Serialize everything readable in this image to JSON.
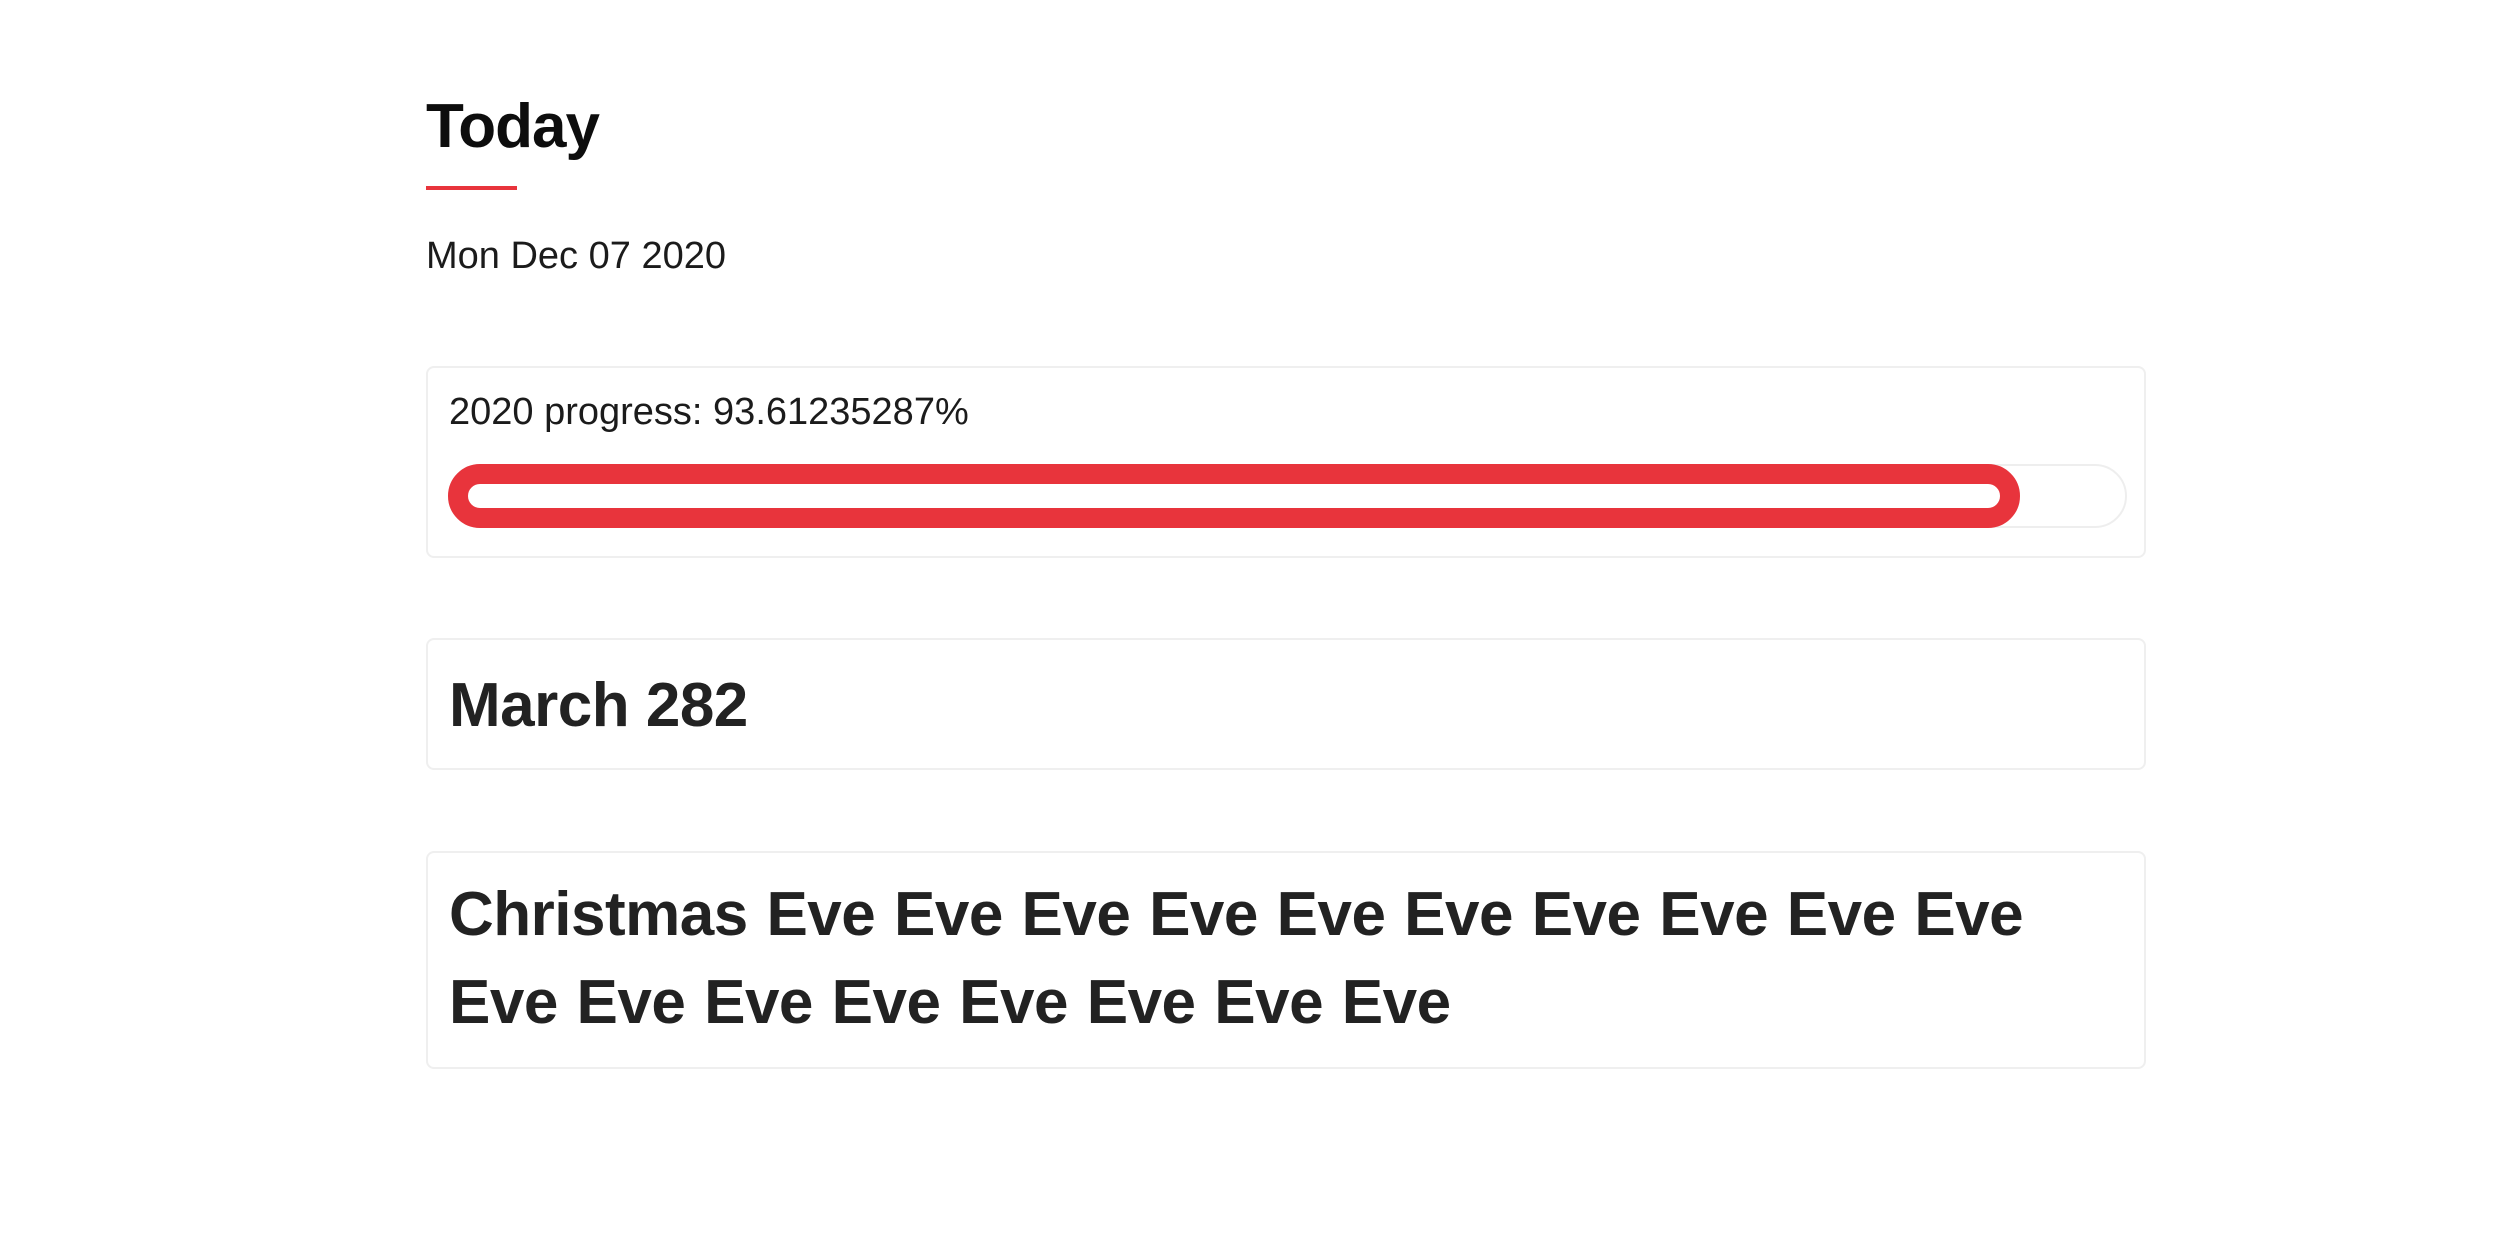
{
  "page": {
    "title": "Today",
    "date": "Mon Dec 07 2020",
    "accent_color": "#e8343c"
  },
  "progress": {
    "label": "2020 progress: 93.61235287%",
    "fraction": 0.9361235287
  },
  "cards": {
    "march_text": "March 282",
    "christmas_text": "Christmas Eve Eve Eve Eve Eve Eve Eve Eve Eve Eve Eve Eve Eve Eve Eve Eve Eve Eve"
  }
}
